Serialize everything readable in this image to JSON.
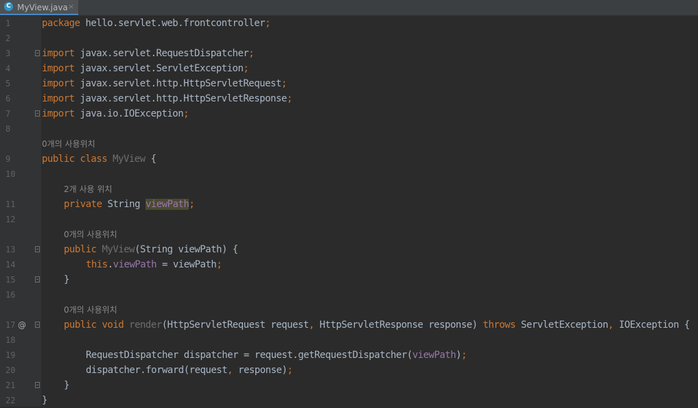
{
  "tab": {
    "icon": "C",
    "label": "MyView.java",
    "close": "×"
  },
  "hints": {
    "h1": "0개의 사용위치",
    "h2": "2개 사용 위치",
    "h3": "0개의 사용위치",
    "h4": "0개의 사용위치"
  },
  "gutter_mark": "@",
  "line_numbers": [
    "1",
    "2",
    "3",
    "4",
    "5",
    "6",
    "7",
    "8",
    "9",
    "10",
    "11",
    "12",
    "13",
    "14",
    "15",
    "16",
    "17",
    "18",
    "19",
    "20",
    "21",
    "22"
  ],
  "code": {
    "l1": {
      "kw": "package",
      "rest": " hello.servlet.web.frontcontroller",
      "semi": ";"
    },
    "l3": {
      "kw": "import",
      "rest": " javax.servlet.RequestDispatcher",
      "semi": ";"
    },
    "l4": {
      "kw": "import",
      "rest": " javax.servlet.ServletException",
      "semi": ";"
    },
    "l5": {
      "kw": "import",
      "rest": " javax.servlet.http.HttpServletRequest",
      "semi": ";"
    },
    "l6": {
      "kw": "import",
      "rest": " javax.servlet.http.HttpServletResponse",
      "semi": ";"
    },
    "l7": {
      "kw": "import",
      "rest": " java.io.IOException",
      "semi": ";"
    },
    "l9": {
      "kw": "public class",
      "cls": " MyView",
      "rest": " {"
    },
    "l11": {
      "kw": "private",
      "type": " String ",
      "fld": "viewPath",
      "semi": ";"
    },
    "l13": {
      "kw": "public",
      "name": " MyView",
      "rest": "(String viewPath) {"
    },
    "l14": {
      "kw": "this",
      "dot": ".",
      "fld": "viewPath",
      "rest": " = viewPath",
      "semi": ";"
    },
    "l15": {
      "rest": "}"
    },
    "l17": {
      "kw": "public void",
      "name": " render",
      "p1": "(HttpServletRequest request",
      "c1": ",",
      "p2": " HttpServletResponse response) ",
      "kw2": "throws",
      "p3": " ServletException",
      "c2": ",",
      "p4": " IOException {"
    },
    "l19": {
      "p1": "RequestDispatcher dispatcher = request.getRequestDispatcher(",
      "fld": "viewPath",
      "p2": ")",
      "semi": ";"
    },
    "l20": {
      "p1": "dispatcher.forward(request",
      "c1": ",",
      "p2": " response)",
      "semi": ";"
    },
    "l21": {
      "rest": "}"
    },
    "l22": {
      "rest": "}"
    }
  }
}
